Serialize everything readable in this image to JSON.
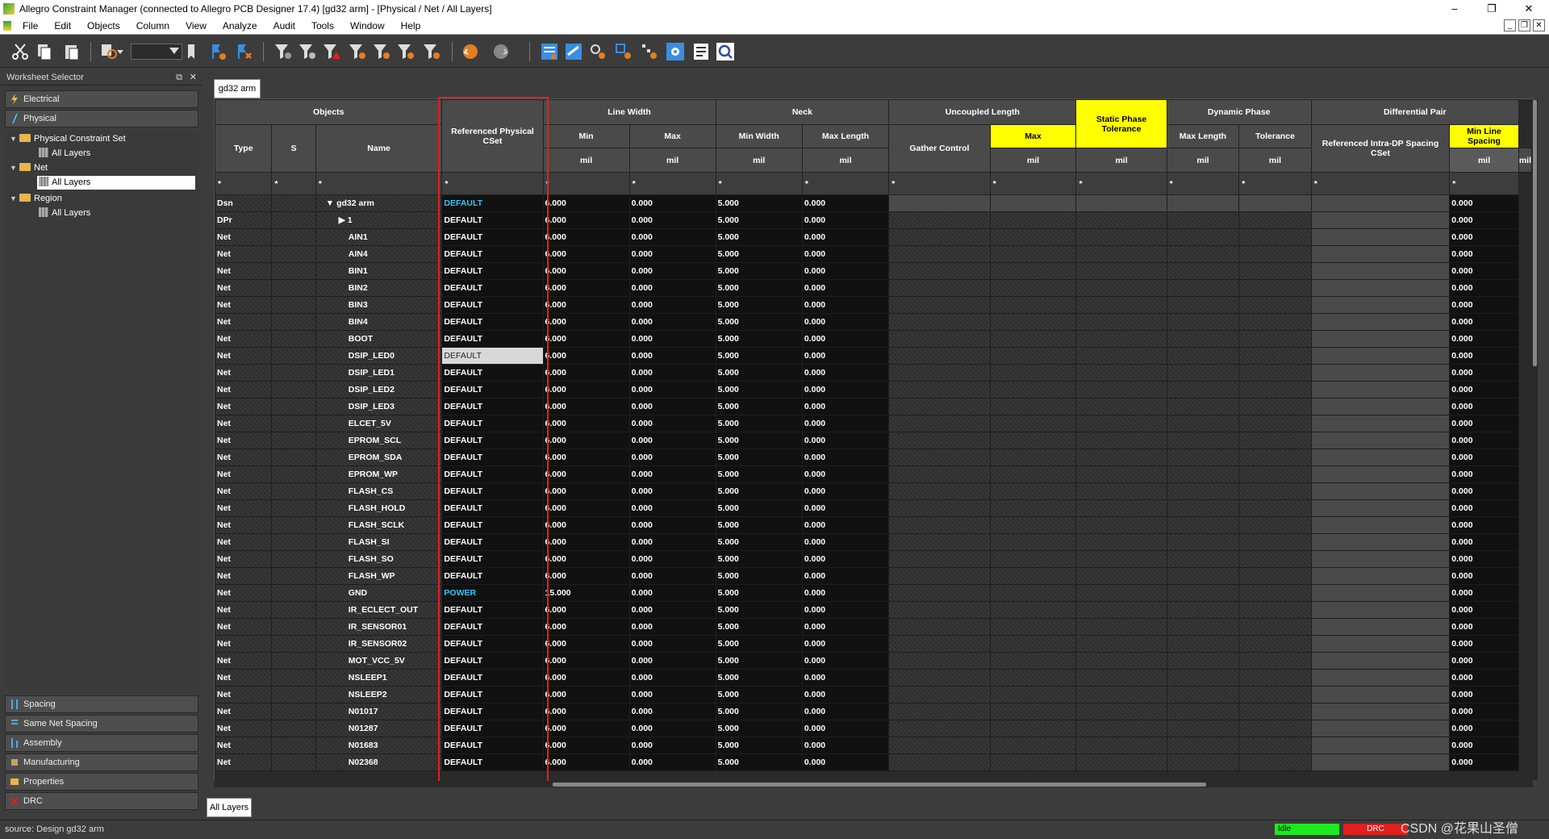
{
  "window": {
    "title": "Allegro Constraint Manager (connected to Allegro PCB Designer 17.4) [gd32 arm] - [Physical / Net / All Layers]",
    "minimize": "–",
    "maximize": "❐",
    "close": "✕"
  },
  "menu": [
    "File",
    "Edit",
    "Objects",
    "Column",
    "View",
    "Analyze",
    "Audit",
    "Tools",
    "Window",
    "Help"
  ],
  "mdi": {
    "min": "_",
    "restore": "❐",
    "close": "✕"
  },
  "toolbar_icons": [
    "cut-icon",
    "copy-icon",
    "paste-icon",
    "find-icon",
    "filter-icons",
    "undo-icon",
    "redo-icon",
    "worksheet-icons",
    "settings-icon",
    "report-icon",
    "search-icon"
  ],
  "worksheet": {
    "title": "Worksheet Selector",
    "pin": "⧉",
    "close": "✕",
    "top_tabs": [
      "Electrical",
      "Physical"
    ],
    "tree": [
      {
        "label": "Physical Constraint Set",
        "level": 0
      },
      {
        "label": "All Layers",
        "level": 1
      },
      {
        "label": "Net",
        "level": 0
      },
      {
        "label": "All Layers",
        "level": 1,
        "selected": true
      },
      {
        "label": "Region",
        "level": 0
      },
      {
        "label": "All Layers",
        "level": 1
      }
    ],
    "bottom_tabs": [
      "Spacing",
      "Same Net Spacing",
      "Assembly",
      "Manufacturing",
      "Properties",
      "DRC"
    ]
  },
  "tab_top": "gd32 arm",
  "tab_bottom": "All Layers",
  "headers": {
    "objects": "Objects",
    "type": "Type",
    "s": "S",
    "name": "Name",
    "ref_cset": "Referenced Physical CSet",
    "line_width": "Line Width",
    "lw_min": "Min",
    "lw_max": "Max",
    "neck": "Neck",
    "neck_min_width": "Min Width",
    "neck_max_length": "Max Length",
    "uncoupled": "Uncoupled Length",
    "gather": "Gather Control",
    "unc_max": "Max",
    "static_phase": "Static Phase Tolerance",
    "dynamic_phase": "Dynamic Phase",
    "dp_max_length": "Max Length",
    "dp_tol": "Tolerance",
    "diff_pair": "Differential Pair",
    "ref_intra": "Referenced Intra-DP Spacing CSet",
    "min_line_spacing": "Min Line Spacing",
    "unit": "mil",
    "filter": "*"
  },
  "rows": [
    {
      "type": "Dsn",
      "name": "gd32 arm",
      "prefix": "▼ ",
      "cset": "DEFAULT",
      "lwmin": "6.000",
      "lwmax": "0.000",
      "nmin": "5.000",
      "nmax": "0.000",
      "mls": "0.000",
      "cy": true
    },
    {
      "type": "DPr",
      "name": "1",
      "prefix": "▶ ",
      "cset": "DEFAULT",
      "lwmin": "6.000",
      "lwmax": "0.000",
      "nmin": "5.000",
      "nmax": "0.000",
      "mls": "0.000"
    },
    {
      "type": "Net",
      "name": "AIN1",
      "cset": "DEFAULT",
      "lwmin": "6.000",
      "lwmax": "0.000",
      "nmin": "5.000",
      "nmax": "0.000",
      "mls": "0.000"
    },
    {
      "type": "Net",
      "name": "AIN4",
      "cset": "DEFAULT",
      "lwmin": "6.000",
      "lwmax": "0.000",
      "nmin": "5.000",
      "nmax": "0.000",
      "mls": "0.000"
    },
    {
      "type": "Net",
      "name": "BIN1",
      "cset": "DEFAULT",
      "lwmin": "6.000",
      "lwmax": "0.000",
      "nmin": "5.000",
      "nmax": "0.000",
      "mls": "0.000"
    },
    {
      "type": "Net",
      "name": "BIN2",
      "cset": "DEFAULT",
      "lwmin": "6.000",
      "lwmax": "0.000",
      "nmin": "5.000",
      "nmax": "0.000",
      "mls": "0.000"
    },
    {
      "type": "Net",
      "name": "BIN3",
      "cset": "DEFAULT",
      "lwmin": "6.000",
      "lwmax": "0.000",
      "nmin": "5.000",
      "nmax": "0.000",
      "mls": "0.000"
    },
    {
      "type": "Net",
      "name": "BIN4",
      "cset": "DEFAULT",
      "lwmin": "6.000",
      "lwmax": "0.000",
      "nmin": "5.000",
      "nmax": "0.000",
      "mls": "0.000"
    },
    {
      "type": "Net",
      "name": "BOOT",
      "cset": "DEFAULT",
      "lwmin": "6.000",
      "lwmax": "0.000",
      "nmin": "5.000",
      "nmax": "0.000",
      "mls": "0.000"
    },
    {
      "type": "Net",
      "name": "DSIP_LED0",
      "cset": "DEFAULT",
      "lwmin": "6.000",
      "lwmax": "0.000",
      "nmin": "5.000",
      "nmax": "0.000",
      "mls": "0.000",
      "sel": true
    },
    {
      "type": "Net",
      "name": "DSIP_LED1",
      "cset": "DEFAULT",
      "lwmin": "6.000",
      "lwmax": "0.000",
      "nmin": "5.000",
      "nmax": "0.000",
      "mls": "0.000"
    },
    {
      "type": "Net",
      "name": "DSIP_LED2",
      "cset": "DEFAULT",
      "lwmin": "6.000",
      "lwmax": "0.000",
      "nmin": "5.000",
      "nmax": "0.000",
      "mls": "0.000"
    },
    {
      "type": "Net",
      "name": "DSIP_LED3",
      "cset": "DEFAULT",
      "lwmin": "6.000",
      "lwmax": "0.000",
      "nmin": "5.000",
      "nmax": "0.000",
      "mls": "0.000"
    },
    {
      "type": "Net",
      "name": "ELCET_5V",
      "cset": "DEFAULT",
      "lwmin": "6.000",
      "lwmax": "0.000",
      "nmin": "5.000",
      "nmax": "0.000",
      "mls": "0.000"
    },
    {
      "type": "Net",
      "name": "EPROM_SCL",
      "cset": "DEFAULT",
      "lwmin": "6.000",
      "lwmax": "0.000",
      "nmin": "5.000",
      "nmax": "0.000",
      "mls": "0.000"
    },
    {
      "type": "Net",
      "name": "EPROM_SDA",
      "cset": "DEFAULT",
      "lwmin": "6.000",
      "lwmax": "0.000",
      "nmin": "5.000",
      "nmax": "0.000",
      "mls": "0.000"
    },
    {
      "type": "Net",
      "name": "EPROM_WP",
      "cset": "DEFAULT",
      "lwmin": "6.000",
      "lwmax": "0.000",
      "nmin": "5.000",
      "nmax": "0.000",
      "mls": "0.000"
    },
    {
      "type": "Net",
      "name": "FLASH_CS",
      "cset": "DEFAULT",
      "lwmin": "6.000",
      "lwmax": "0.000",
      "nmin": "5.000",
      "nmax": "0.000",
      "mls": "0.000"
    },
    {
      "type": "Net",
      "name": "FLASH_HOLD",
      "cset": "DEFAULT",
      "lwmin": "6.000",
      "lwmax": "0.000",
      "nmin": "5.000",
      "nmax": "0.000",
      "mls": "0.000"
    },
    {
      "type": "Net",
      "name": "FLASH_SCLK",
      "cset": "DEFAULT",
      "lwmin": "6.000",
      "lwmax": "0.000",
      "nmin": "5.000",
      "nmax": "0.000",
      "mls": "0.000"
    },
    {
      "type": "Net",
      "name": "FLASH_SI",
      "cset": "DEFAULT",
      "lwmin": "6.000",
      "lwmax": "0.000",
      "nmin": "5.000",
      "nmax": "0.000",
      "mls": "0.000"
    },
    {
      "type": "Net",
      "name": "FLASH_SO",
      "cset": "DEFAULT",
      "lwmin": "6.000",
      "lwmax": "0.000",
      "nmin": "5.000",
      "nmax": "0.000",
      "mls": "0.000"
    },
    {
      "type": "Net",
      "name": "FLASH_WP",
      "cset": "DEFAULT",
      "lwmin": "6.000",
      "lwmax": "0.000",
      "nmin": "5.000",
      "nmax": "0.000",
      "mls": "0.000"
    },
    {
      "type": "Net",
      "name": "GND",
      "cset": "POWER",
      "lwmin": "15.000",
      "lwmax": "0.000",
      "nmin": "5.000",
      "nmax": "0.000",
      "mls": "0.000",
      "cy": true
    },
    {
      "type": "Net",
      "name": "IR_ECLECT_OUT",
      "cset": "DEFAULT",
      "lwmin": "6.000",
      "lwmax": "0.000",
      "nmin": "5.000",
      "nmax": "0.000",
      "mls": "0.000"
    },
    {
      "type": "Net",
      "name": "IR_SENSOR01",
      "cset": "DEFAULT",
      "lwmin": "6.000",
      "lwmax": "0.000",
      "nmin": "5.000",
      "nmax": "0.000",
      "mls": "0.000"
    },
    {
      "type": "Net",
      "name": "IR_SENSOR02",
      "cset": "DEFAULT",
      "lwmin": "6.000",
      "lwmax": "0.000",
      "nmin": "5.000",
      "nmax": "0.000",
      "mls": "0.000"
    },
    {
      "type": "Net",
      "name": "MOT_VCC_5V",
      "cset": "DEFAULT",
      "lwmin": "6.000",
      "lwmax": "0.000",
      "nmin": "5.000",
      "nmax": "0.000",
      "mls": "0.000"
    },
    {
      "type": "Net",
      "name": "NSLEEP1",
      "cset": "DEFAULT",
      "lwmin": "6.000",
      "lwmax": "0.000",
      "nmin": "5.000",
      "nmax": "0.000",
      "mls": "0.000"
    },
    {
      "type": "Net",
      "name": "NSLEEP2",
      "cset": "DEFAULT",
      "lwmin": "6.000",
      "lwmax": "0.000",
      "nmin": "5.000",
      "nmax": "0.000",
      "mls": "0.000"
    },
    {
      "type": "Net",
      "name": "N01017",
      "cset": "DEFAULT",
      "lwmin": "6.000",
      "lwmax": "0.000",
      "nmin": "5.000",
      "nmax": "0.000",
      "mls": "0.000"
    },
    {
      "type": "Net",
      "name": "N01287",
      "cset": "DEFAULT",
      "lwmin": "6.000",
      "lwmax": "0.000",
      "nmin": "5.000",
      "nmax": "0.000",
      "mls": "0.000"
    },
    {
      "type": "Net",
      "name": "N01683",
      "cset": "DEFAULT",
      "lwmin": "6.000",
      "lwmax": "0.000",
      "nmin": "5.000",
      "nmax": "0.000",
      "mls": "0.000"
    },
    {
      "type": "Net",
      "name": "N02368",
      "cset": "DEFAULT",
      "lwmin": "6.000",
      "lwmax": "0.000",
      "nmin": "5.000",
      "nmax": "0.000",
      "mls": "0.000"
    }
  ],
  "status": {
    "source": "source: Design gd32 arm",
    "idle": "Idle",
    "drc": "DRC",
    "watermark": "CSDN @花果山圣僧"
  },
  "colors": {
    "highlight": "#ffff00",
    "cyan": "#29c8ff",
    "redbox": "#e0201e",
    "idle": "#1ee81e"
  }
}
